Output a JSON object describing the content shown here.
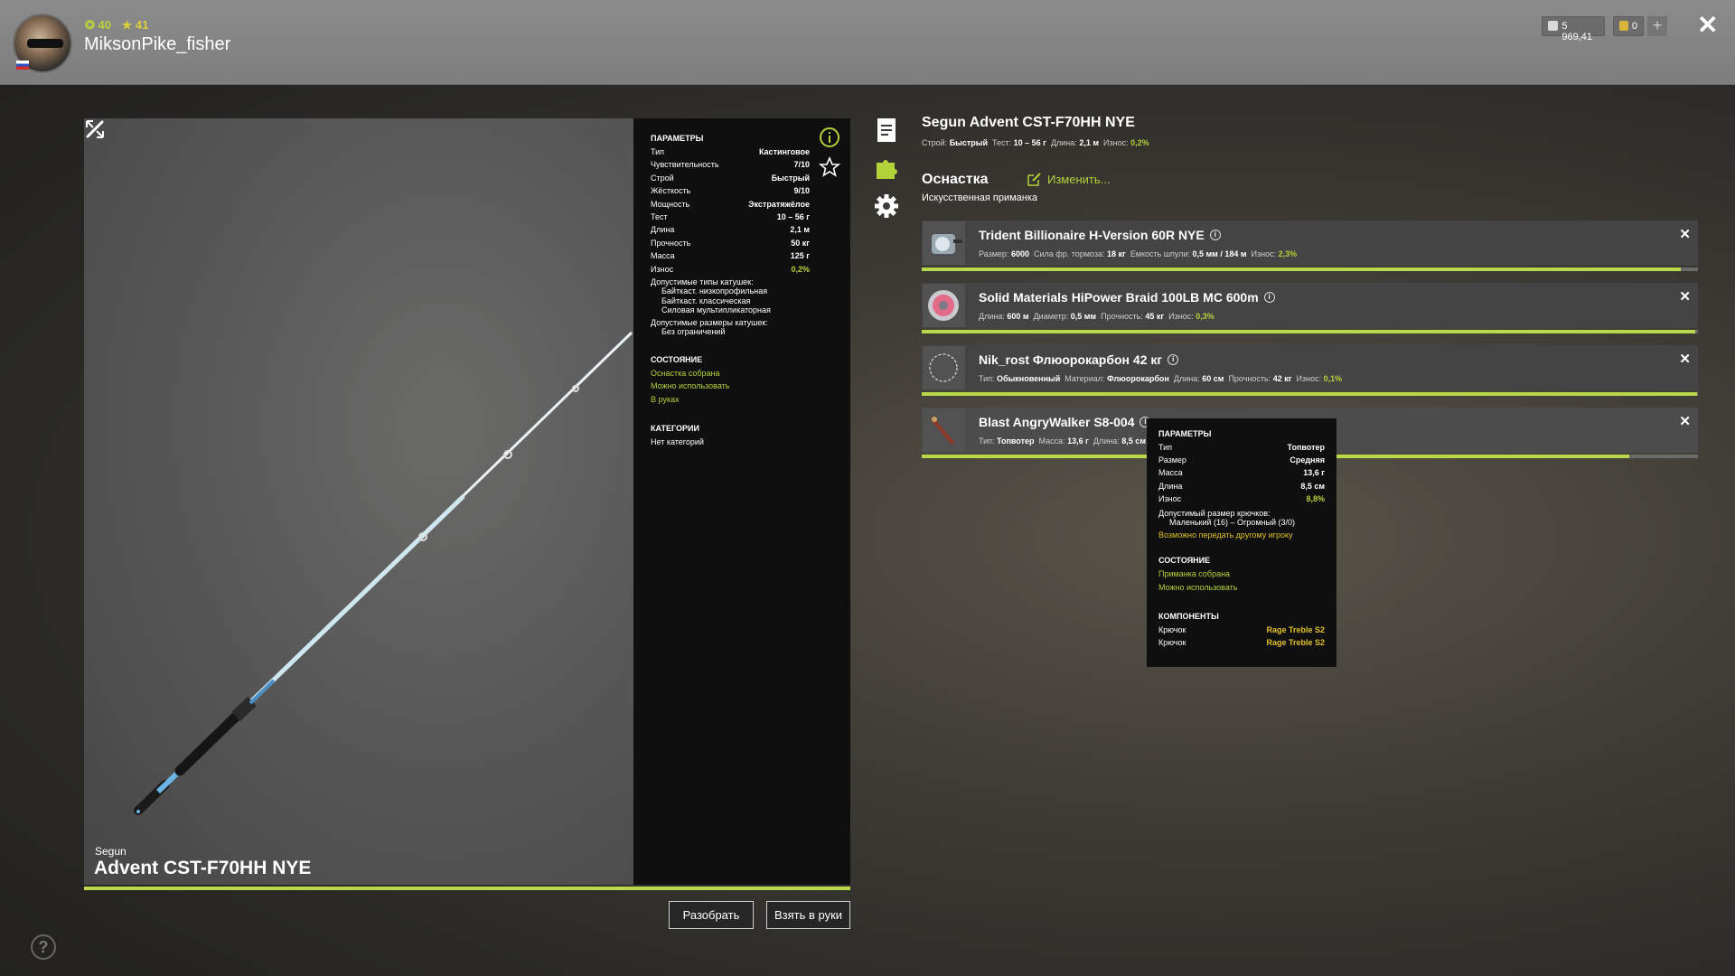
{
  "header": {
    "level": "40",
    "rank": "41",
    "player_name": "MiksonPike_fisher",
    "silver": "5 969,41",
    "gold": "0",
    "add_label": "+",
    "close_label": "✕"
  },
  "preview": {
    "brand": "Segun",
    "model": "Advent CST-F70HH NYE"
  },
  "params": {
    "title": "ПАРАМЕТРЫ",
    "rows": [
      {
        "k": "Тип",
        "v": "Кастинговое"
      },
      {
        "k": "Чувствительность",
        "v": "7/10"
      },
      {
        "k": "Строй",
        "v": "Быстрый"
      },
      {
        "k": "Жёсткость",
        "v": "9/10"
      },
      {
        "k": "Мощность",
        "v": "Экстратяжёлое"
      },
      {
        "k": "Тест",
        "v": "10 – 56 г"
      },
      {
        "k": "Длина",
        "v": "2,1 м"
      },
      {
        "k": "Прочность",
        "v": "50 кг"
      },
      {
        "k": "Масса",
        "v": "125 г"
      },
      {
        "k": "Износ",
        "v": "0,2%"
      }
    ],
    "reel_types_label": "Допустимые типы катушек:",
    "reel_types": [
      "Байткаст. низкопрофильная",
      "Байткаст. классическая",
      "Силовая мультипликаторная"
    ],
    "reel_sizes_label": "Допустимые размеры катушек:",
    "reel_sizes": "Без ограничений",
    "state_title": "СОСТОЯНИЕ",
    "state": [
      "Оснастка собрана",
      "Можно использовать",
      "В руках"
    ],
    "categories_title": "КАТЕГОРИИ",
    "categories": "Нет категорий"
  },
  "buttons": {
    "disassemble": "Разобрать",
    "equip": "Взять в руки"
  },
  "help_label": "?",
  "rod": {
    "title": "Segun Advent CST-F70HH NYE",
    "summary": [
      {
        "k": "Строй:",
        "v": "Быстрый"
      },
      {
        "k": "Тест:",
        "v": "10 – 56 г"
      },
      {
        "k": "Длина:",
        "v": "2,1 м"
      },
      {
        "k": "Износ:",
        "v": "0,2%",
        "green": true
      }
    ]
  },
  "tackle": {
    "title": "Оснастка",
    "change_label": "Изменить...",
    "type": "Искусственная приманка"
  },
  "slots": [
    {
      "name": "Trident Billionaire H-Version 60R NYE",
      "details": [
        {
          "k": "Размер:",
          "v": "6000"
        },
        {
          "k": "Сила фр. тормоза:",
          "v": "18 кг"
        },
        {
          "k": "Емкость шпули:",
          "v": "0,5 мм / 184 м"
        },
        {
          "k": "Износ:",
          "v": "2,3%",
          "green": true
        }
      ],
      "condition": 0.978
    },
    {
      "name": "Solid Materials HiPower Braid 100LB MC 600m",
      "details": [
        {
          "k": "Длина:",
          "v": "600 м"
        },
        {
          "k": "Диаметр:",
          "v": "0,5 мм"
        },
        {
          "k": "Прочность:",
          "v": "45 кг"
        },
        {
          "k": "Износ:",
          "v": "0,3%",
          "green": true
        }
      ],
      "condition": 0.997
    },
    {
      "name": "Nik_rost Флюорокарбон 42 кг",
      "details": [
        {
          "k": "Тип:",
          "v": "Обыкновенный"
        },
        {
          "k": "Материал:",
          "v": "Флюорокарбон"
        },
        {
          "k": "Длина:",
          "v": "60 см"
        },
        {
          "k": "Прочность:",
          "v": "42 кг"
        },
        {
          "k": "Износ:",
          "v": "0,1%",
          "green": true
        }
      ],
      "condition": 0.999
    },
    {
      "name": "Blast AngryWalker S8-004",
      "details": [
        {
          "k": "Тип:",
          "v": "Топвотер"
        },
        {
          "k": "Масса:",
          "v": "13,6 г"
        },
        {
          "k": "Длина:",
          "v": "8,5 см"
        }
      ],
      "condition": 0.912
    }
  ],
  "tooltip": {
    "title": "ПАРАМЕТРЫ",
    "rows": [
      {
        "k": "Тип",
        "v": "Топвотер"
      },
      {
        "k": "Размер",
        "v": "Средняя"
      },
      {
        "k": "Масса",
        "v": "13,6 г"
      },
      {
        "k": "Длина",
        "v": "8,5 см"
      },
      {
        "k": "Износ",
        "v": "8,8%"
      }
    ],
    "hook_size_label": "Допустимый размер крючков:",
    "hook_size": "Маленький (16) – Огромный (3/0)",
    "transfer": "Возможно передать другому игроку",
    "state_title": "СОСТОЯНИЕ",
    "state": [
      "Приманка собрана",
      "Можно использовать"
    ],
    "components_title": "КОМПОНЕНТЫ",
    "components": [
      {
        "k": "Крючок",
        "v": "Rage Treble S2"
      },
      {
        "k": "Крючок",
        "v": "Rage Treble S2"
      }
    ]
  },
  "colors": {
    "accent": "#b3d23a",
    "bar": "#b9d84a",
    "gold_text": "#e1c12a"
  }
}
